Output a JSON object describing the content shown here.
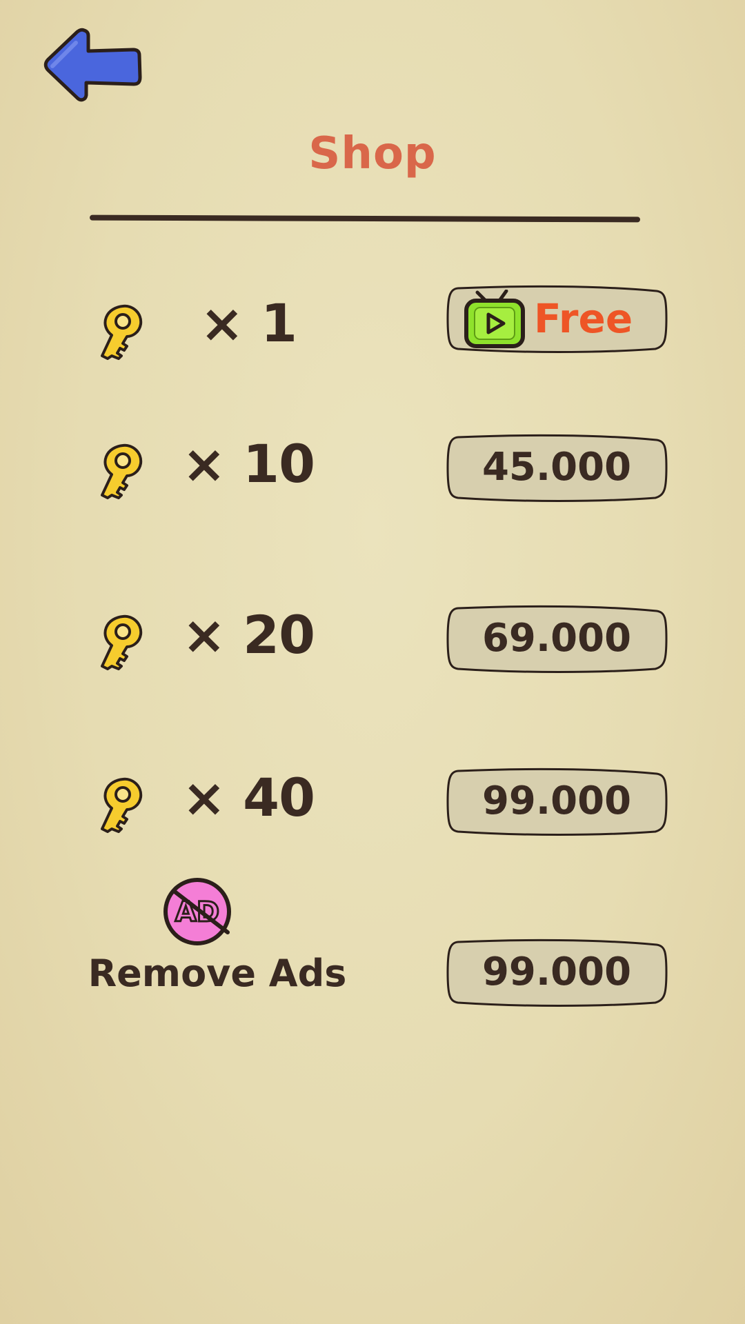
{
  "screen": {
    "title": "Shop",
    "title_color": "#d9674a",
    "background_color": "#e8deb5",
    "text_color": "#3a2a22"
  },
  "icons": {
    "back": "back-arrow-icon",
    "key": "key-icon",
    "video": "tv-play-icon",
    "no_ads": "no-ads-icon"
  },
  "items": [
    {
      "quantity": "× 1",
      "price": "Free",
      "free": true
    },
    {
      "quantity": "× 10",
      "price": "45.000",
      "free": false
    },
    {
      "quantity": "× 20",
      "price": "69.000",
      "free": false
    },
    {
      "quantity": "× 40",
      "price": "99.000",
      "free": false
    }
  ],
  "remove_ads": {
    "label": "Remove Ads",
    "price": "99.000",
    "badge_text": "AD"
  }
}
